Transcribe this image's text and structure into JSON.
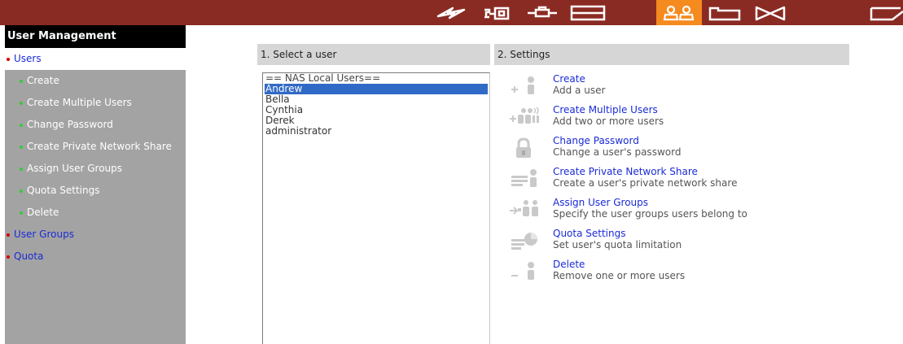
{
  "toolbar": {
    "icons": [
      {
        "name": "system-icon",
        "active": false
      },
      {
        "name": "network-icon",
        "active": false
      },
      {
        "name": "device-icon",
        "active": false
      },
      {
        "name": "storage-icon",
        "active": false
      },
      {
        "name": "users-icon",
        "active": true
      },
      {
        "name": "share-folder-icon",
        "active": false
      },
      {
        "name": "application-icon",
        "active": false
      },
      {
        "name": "backup-icon",
        "active": false
      }
    ],
    "active_color": "#f58a1f",
    "bar_color": "#8a2b23"
  },
  "sidebar": {
    "title": "User Management",
    "items": [
      {
        "label": "Users",
        "level": "top",
        "selected": true
      },
      {
        "label": "Create",
        "level": "sub"
      },
      {
        "label": "Create Multiple Users",
        "level": "sub"
      },
      {
        "label": "Change Password",
        "level": "sub"
      },
      {
        "label": "Create Private Network Share",
        "level": "sub"
      },
      {
        "label": "Assign User Groups",
        "level": "sub"
      },
      {
        "label": "Quota Settings",
        "level": "sub"
      },
      {
        "label": "Delete",
        "level": "sub"
      },
      {
        "label": "User Groups",
        "level": "top"
      },
      {
        "label": "Quota",
        "level": "top"
      }
    ]
  },
  "select_user": {
    "header": "1. Select a user",
    "items": [
      {
        "label": "== NAS Local Users==",
        "kind": "group"
      },
      {
        "label": "Andrew",
        "kind": "user",
        "selected": true
      },
      {
        "label": "Bella",
        "kind": "user"
      },
      {
        "label": "Cynthia",
        "kind": "user"
      },
      {
        "label": "Derek",
        "kind": "user"
      },
      {
        "label": "administrator",
        "kind": "user"
      }
    ]
  },
  "settings": {
    "header": "2. Settings",
    "actions": [
      {
        "label": "Create",
        "description": "Add a user",
        "icon": "add-user-icon"
      },
      {
        "label": "Create Multiple Users",
        "description": "Add two or more users",
        "icon": "add-multiple-users-icon"
      },
      {
        "label": "Change Password",
        "description": "Change a user's password",
        "icon": "lock-icon"
      },
      {
        "label": "Create Private Network Share",
        "description": "Create a user's private network share",
        "icon": "private-share-icon"
      },
      {
        "label": "Assign User Groups",
        "description": "Specify the user groups users belong to",
        "icon": "assign-group-icon"
      },
      {
        "label": "Quota Settings",
        "description": "Set user's quota limitation",
        "icon": "quota-icon"
      },
      {
        "label": "Delete",
        "description": "Remove one or more users",
        "icon": "delete-user-icon"
      }
    ]
  }
}
